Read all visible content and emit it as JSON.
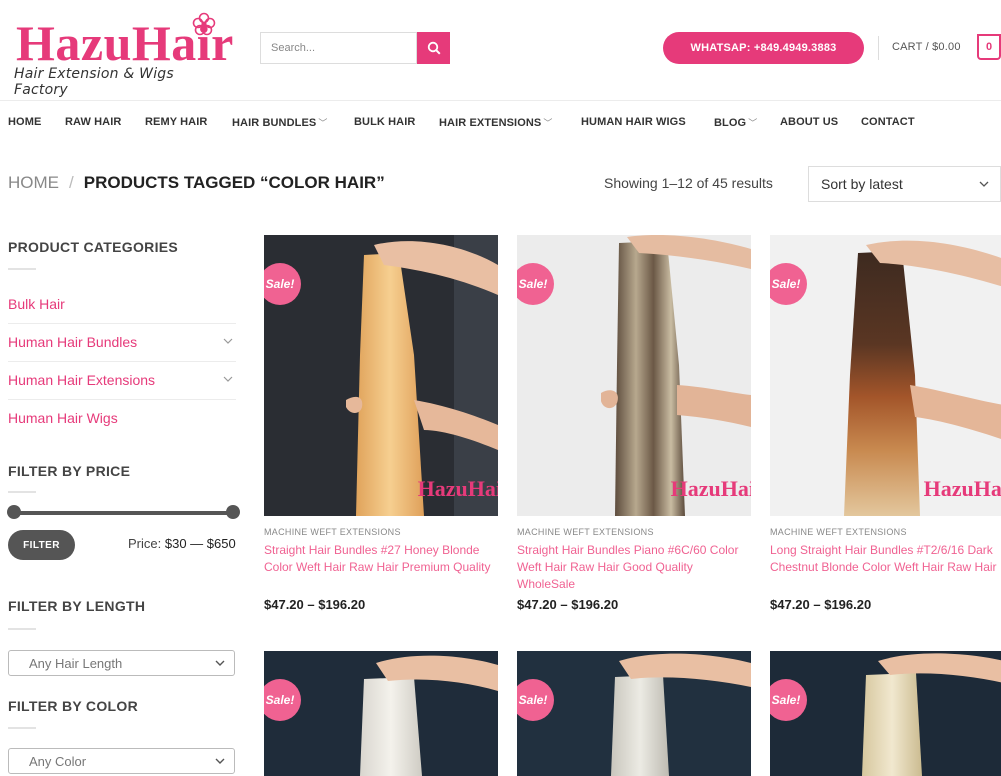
{
  "brand": {
    "name": "HazuHair",
    "tagline": "Hair Extension & Wigs Factory",
    "accent": "#e63a7a"
  },
  "search": {
    "placeholder": "Search..."
  },
  "header": {
    "whatsapp": "WHATSAP: +849.4949.3883",
    "cart_label": "CART / $0.00",
    "cart_count": "0"
  },
  "nav": {
    "items": [
      {
        "label": "HOME",
        "dropdown": false
      },
      {
        "label": "RAW HAIR",
        "dropdown": false
      },
      {
        "label": "REMY HAIR",
        "dropdown": false
      },
      {
        "label": "HAIR BUNDLES",
        "dropdown": true
      },
      {
        "label": "BULK HAIR",
        "dropdown": false
      },
      {
        "label": "HAIR EXTENSIONS",
        "dropdown": true
      },
      {
        "label": "HUMAN HAIR WIGS",
        "dropdown": false
      },
      {
        "label": "BLOG",
        "dropdown": true
      },
      {
        "label": "ABOUT US",
        "dropdown": false
      },
      {
        "label": "CONTACT",
        "dropdown": false
      }
    ]
  },
  "breadcrumb": {
    "home": "HOME",
    "separator": "/",
    "current": "PRODUCTS TAGGED “COLOR HAIR”"
  },
  "results": {
    "text": "Showing 1–12 of 45 results"
  },
  "sort": {
    "selected": "Sort by latest"
  },
  "sidebar": {
    "categories_title": "PRODUCT CATEGORIES",
    "categories": [
      {
        "label": "Bulk Hair",
        "expandable": false
      },
      {
        "label": "Human Hair Bundles",
        "expandable": true
      },
      {
        "label": "Human Hair Extensions",
        "expandable": true
      },
      {
        "label": "Human Hair Wigs",
        "expandable": false
      }
    ],
    "price_title": "FILTER BY PRICE",
    "filter_button": "FILTER",
    "price_label": "Price:",
    "price_range": "$30 — $650",
    "length_title": "FILTER BY LENGTH",
    "length_select": "Any Hair Length",
    "color_title": "FILTER BY COLOR",
    "color_select": "Any Color"
  },
  "products": [
    {
      "sale": "Sale!",
      "category": "MACHINE WEFT EXTENSIONS",
      "title": "Straight Hair Bundles #27 Honey Blonde Color Weft Hair Raw Hair Premium Quality",
      "price": "$47.20 – $196.20",
      "watermark": "HazuHai",
      "hair_colors": [
        "#f2c27c",
        "#e0a35b"
      ],
      "bg": "#2a2d33"
    },
    {
      "sale": "Sale!",
      "category": "MACHINE WEFT EXTENSIONS",
      "title": "Straight Hair Bundles Piano #6C/60 Color Weft Hair Raw Hair Good Quality WholeSale",
      "price": "$47.20 – $196.20",
      "watermark": "HazuHai",
      "hair_colors": [
        "#6b5846",
        "#b7a88e"
      ],
      "bg": "#ececec"
    },
    {
      "sale": "Sale!",
      "category": "MACHINE WEFT EXTENSIONS",
      "title": "Long Straight Hair Bundles #T2/6/16 Dark Chestnut Blonde Color Weft Hair Raw Hair",
      "price": "$47.20 – $196.20",
      "watermark": "HazuHai",
      "hair_colors": [
        "#3d2a20",
        "#a3552a",
        "#d9b184"
      ],
      "bg": "#f1f1f1"
    },
    {
      "sale": "Sale!",
      "hair_colors": [
        "#f1efe9",
        "#d9d6cf"
      ],
      "bg": "#1f2c3a"
    },
    {
      "sale": "Sale!",
      "hair_colors": [
        "#e8e6df",
        "#c9c6bd"
      ],
      "bg": "#21303f"
    },
    {
      "sale": "Sale!",
      "hair_colors": [
        "#ece2c6",
        "#d6c79e"
      ],
      "bg": "#1d2a38"
    }
  ]
}
